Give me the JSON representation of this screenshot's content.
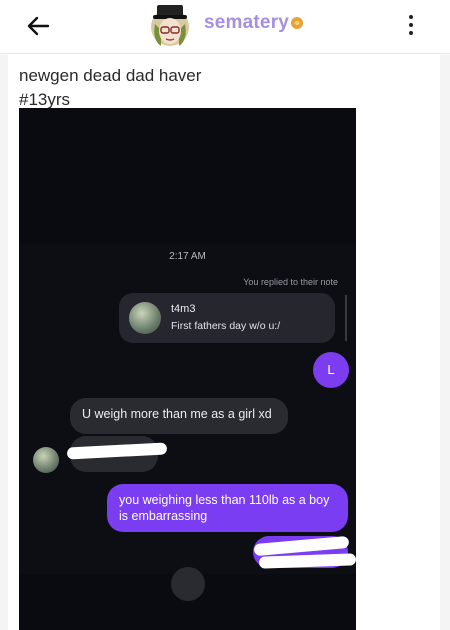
{
  "header": {
    "username": "sematery",
    "back_icon": "arrow-left-icon",
    "menu_icon": "more-vertical-icon",
    "badge_icon": "gold-badge-icon",
    "accent_color": "#a68ee0"
  },
  "post": {
    "line1": "newgen dead dad haver",
    "line2": "#13yrs"
  },
  "chat": {
    "timestamp": "2:17 AM",
    "replied_label": "You replied to their note",
    "note": {
      "name": "t4m3",
      "text": "First fathers day w/o u:/"
    },
    "my_avatar_letter": "L",
    "incoming": [
      "U weigh more than me as a girl xd"
    ],
    "outgoing": [
      "you weighing less than 110lb as a boy is embarrassing"
    ],
    "bubble_color_out": "#7a3df2",
    "bubble_color_in": "#2a2b31"
  }
}
